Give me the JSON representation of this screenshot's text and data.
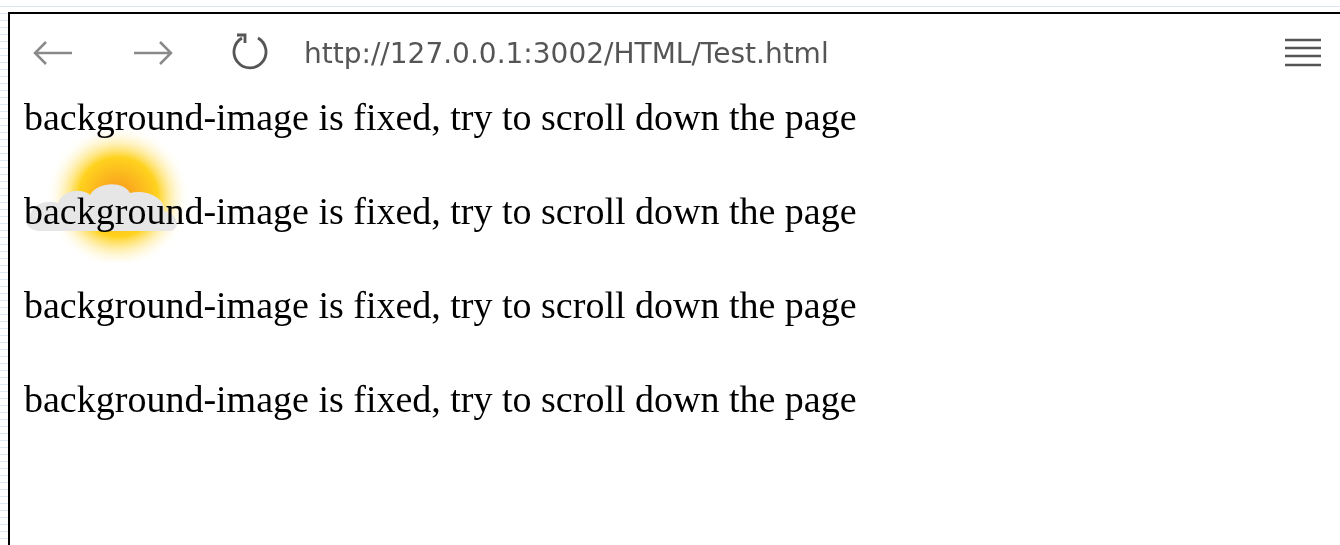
{
  "toolbar": {
    "url": "http://127.0.0.1:3002/HTML/Test.html"
  },
  "page": {
    "lines": [
      "background-image is fixed, try to scroll down the page",
      "background-image is fixed, try to scroll down the page",
      "background-image is fixed, try to scroll down the page",
      "background-image is fixed, try to scroll down the page"
    ]
  }
}
